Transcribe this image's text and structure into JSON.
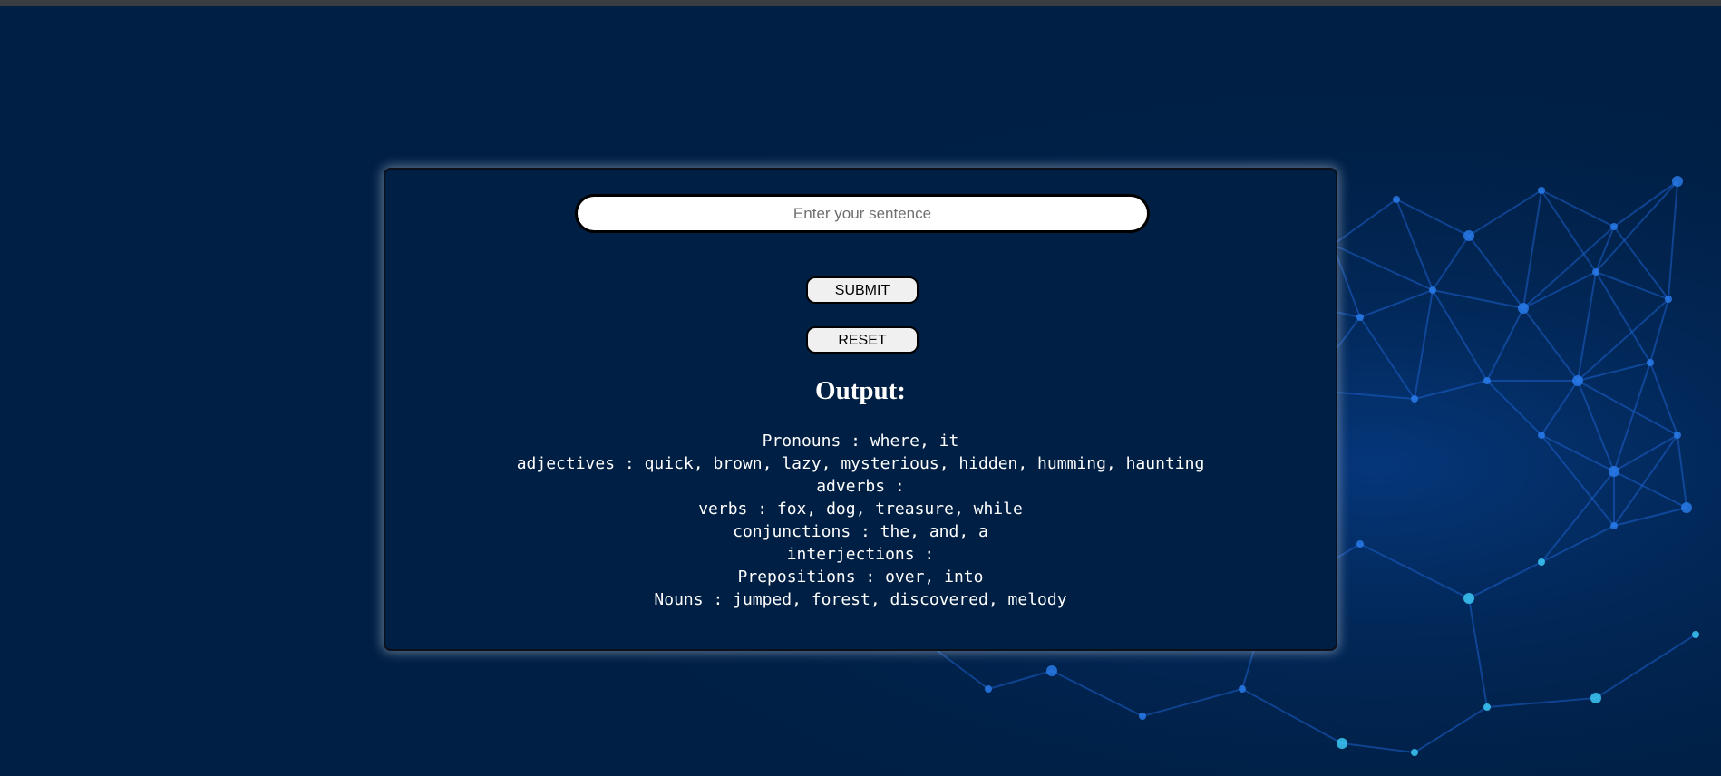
{
  "form": {
    "input_placeholder": "Enter your sentence",
    "input_value": "",
    "submit_label": "SUBMIT",
    "reset_label": "RESET"
  },
  "output": {
    "title": "Output:",
    "lines": [
      "Pronouns : where, it",
      "adjectives : quick, brown, lazy, mysterious, hidden, humming, haunting",
      "adverbs :",
      "verbs : fox, dog, treasure, while",
      "conjunctions : the, and, a",
      "interjections :",
      "Prepositions : over, into",
      "Nouns : jumped, forest, discovered, melody"
    ]
  },
  "colors": {
    "page_background": "#001f44",
    "network_accent": "#1e6fe0",
    "text": "#ffffff"
  }
}
